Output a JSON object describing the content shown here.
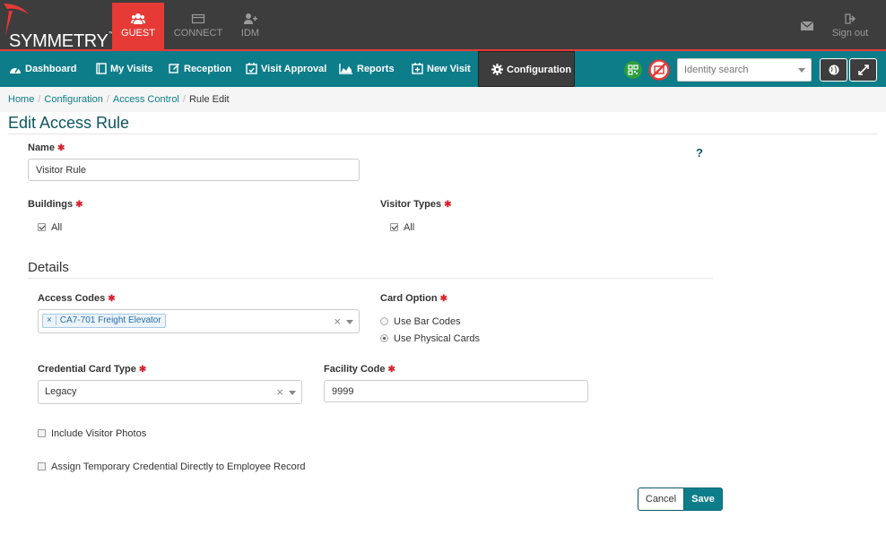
{
  "app": {
    "logo_text": "SYMMETRY",
    "logo_tm": "™",
    "top_tabs": [
      {
        "label": "GUEST",
        "icon": "users-icon",
        "active": true
      },
      {
        "label": "CONNECT",
        "icon": "card-icon",
        "active": false
      },
      {
        "label": "IDM",
        "icon": "user-plus-icon",
        "active": false
      }
    ],
    "sign_out": "Sign out"
  },
  "nav": {
    "items": [
      {
        "label": "Dashboard",
        "icon": "dashboard-icon"
      },
      {
        "label": "My Visits",
        "icon": "book-icon"
      },
      {
        "label": "Reception",
        "icon": "edit-icon"
      },
      {
        "label": "Visit Approval",
        "icon": "calendar-check-icon"
      },
      {
        "label": "Reports",
        "icon": "area-chart-icon"
      },
      {
        "label": "New Visit",
        "icon": "calendar-plus-icon"
      },
      {
        "label": "Configuration",
        "icon": "gear-icon",
        "active": true
      }
    ],
    "search_placeholder": "Identity search"
  },
  "breadcrumb": {
    "home": "Home",
    "configuration": "Configuration",
    "access_control": "Access Control",
    "current": "Rule Edit",
    "separator": "/"
  },
  "page": {
    "title": "Edit Access Rule",
    "help": "?"
  },
  "form": {
    "name_label": "Name",
    "name_value": "Visitor Rule",
    "buildings_label": "Buildings",
    "buildings_all": "All",
    "visitor_types_label": "Visitor Types",
    "visitor_types_all": "All",
    "details_title": "Details",
    "access_codes_label": "Access Codes",
    "access_codes_tag": "CA7-701 Freight Elevator",
    "card_option_label": "Card Option",
    "card_options": [
      "Use Bar Codes",
      "Use Physical Cards"
    ],
    "card_option_selected": 1,
    "credential_card_type_label": "Credential Card Type",
    "credential_card_type_value": "Legacy",
    "facility_code_label": "Facility Code",
    "facility_code_value": "9999",
    "include_photos_label": "Include Visitor Photos",
    "assign_temp_label": "Assign Temporary Credential Directly to Employee Record",
    "required_mark": "✱",
    "clear_mark": "×"
  },
  "actions": {
    "cancel": "Cancel",
    "save": "Save"
  },
  "colors": {
    "topbar": "#3d3d3d",
    "accent_red": "#e53a35",
    "nav_teal": "#0e7d8a",
    "title_teal": "#0e5560",
    "required_red": "#d9232d"
  }
}
